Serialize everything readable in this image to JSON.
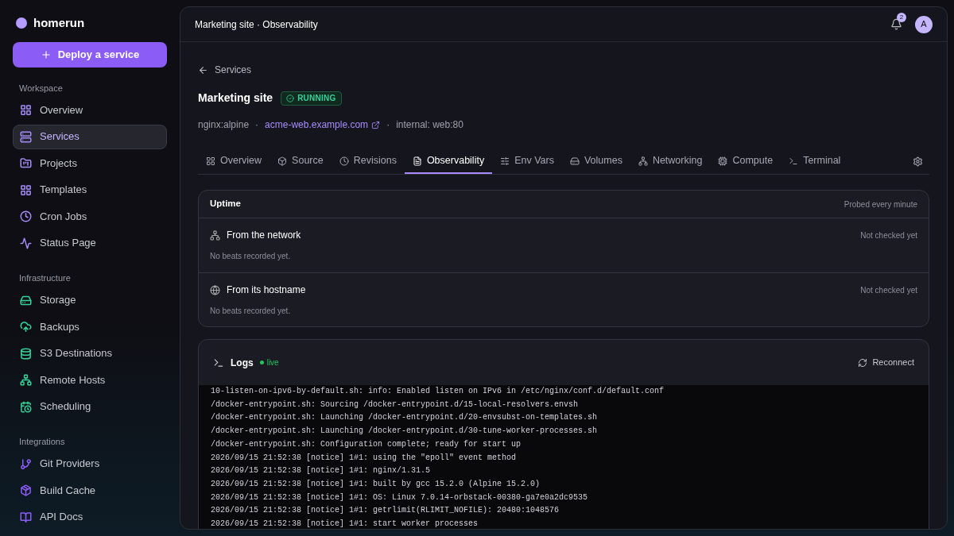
{
  "brand": {
    "name": "homerun"
  },
  "deploy_button": {
    "label": "Deploy a service"
  },
  "sidebar": {
    "sections": [
      {
        "title": "Workspace",
        "color": "#a78bfa",
        "items": [
          {
            "label": "Overview",
            "selected": false
          },
          {
            "label": "Services",
            "selected": true
          },
          {
            "label": "Projects",
            "selected": false
          },
          {
            "label": "Templates",
            "selected": false
          },
          {
            "label": "Cron Jobs",
            "selected": false
          },
          {
            "label": "Status Page",
            "selected": false
          }
        ]
      },
      {
        "title": "Infrastructure",
        "color": "#34d399",
        "items": [
          {
            "label": "Storage",
            "selected": false
          },
          {
            "label": "Backups",
            "selected": false
          },
          {
            "label": "S3 Destinations",
            "selected": false
          },
          {
            "label": "Remote Hosts",
            "selected": false
          },
          {
            "label": "Scheduling",
            "selected": false
          }
        ]
      },
      {
        "title": "Integrations",
        "color": "#8b5cf6",
        "items": [
          {
            "label": "Git Providers",
            "selected": false
          },
          {
            "label": "Build Cache",
            "selected": false
          },
          {
            "label": "API Docs",
            "selected": false
          }
        ]
      }
    ]
  },
  "header": {
    "title": "Marketing site · Observability",
    "notifications": "2",
    "avatar": "A"
  },
  "back_link": "Services",
  "service": {
    "name": "Marketing site",
    "status": "RUNNING",
    "image": "nginx:alpine",
    "separator": "·",
    "domain": "acme-web.example.com",
    "internal": "internal: web:80"
  },
  "tabs": [
    {
      "label": "Overview",
      "selected": false
    },
    {
      "label": "Source",
      "selected": false
    },
    {
      "label": "Revisions",
      "selected": false
    },
    {
      "label": "Observability",
      "selected": true
    },
    {
      "label": "Env Vars",
      "selected": false
    },
    {
      "label": "Volumes",
      "selected": false
    },
    {
      "label": "Networking",
      "selected": false
    },
    {
      "label": "Compute",
      "selected": false
    },
    {
      "label": "Terminal",
      "selected": false
    }
  ],
  "uptime": {
    "title": "Uptime",
    "note": "Probed every minute",
    "checks": [
      {
        "title": "From the network",
        "status": "Not checked yet",
        "detail": "No beats recorded yet."
      },
      {
        "title": "From its hostname",
        "status": "Not checked yet",
        "detail": "No beats recorded yet."
      }
    ]
  },
  "logs": {
    "title": "Logs",
    "live": "live",
    "reconnect": "Reconnect",
    "lines": [
      "10-listen-on-ipv6-by-default.sh: info: Enabled listen on IPv6 in /etc/nginx/conf.d/default.conf",
      "/docker-entrypoint.sh: Sourcing /docker-entrypoint.d/15-local-resolvers.envsh",
      "/docker-entrypoint.sh: Launching /docker-entrypoint.d/20-envsubst-on-templates.sh",
      "/docker-entrypoint.sh: Launching /docker-entrypoint.d/30-tune-worker-processes.sh",
      "/docker-entrypoint.sh: Configuration complete; ready for start up",
      "2026/09/15 21:52:38 [notice] 1#1: using the \"epoll\" event method",
      "2026/09/15 21:52:38 [notice] 1#1: nginx/1.31.5",
      "2026/09/15 21:52:38 [notice] 1#1: built by gcc 15.2.0 (Alpine 15.2.0)",
      "2026/09/15 21:52:38 [notice] 1#1: OS: Linux 7.0.14-orbstack-00380-ga7e0a2dc9535",
      "2026/09/15 21:52:38 [notice] 1#1: getrlimit(RLIMIT_NOFILE): 20480:1048576",
      "2026/09/15 21:52:38 [notice] 1#1: start worker processes"
    ]
  }
}
